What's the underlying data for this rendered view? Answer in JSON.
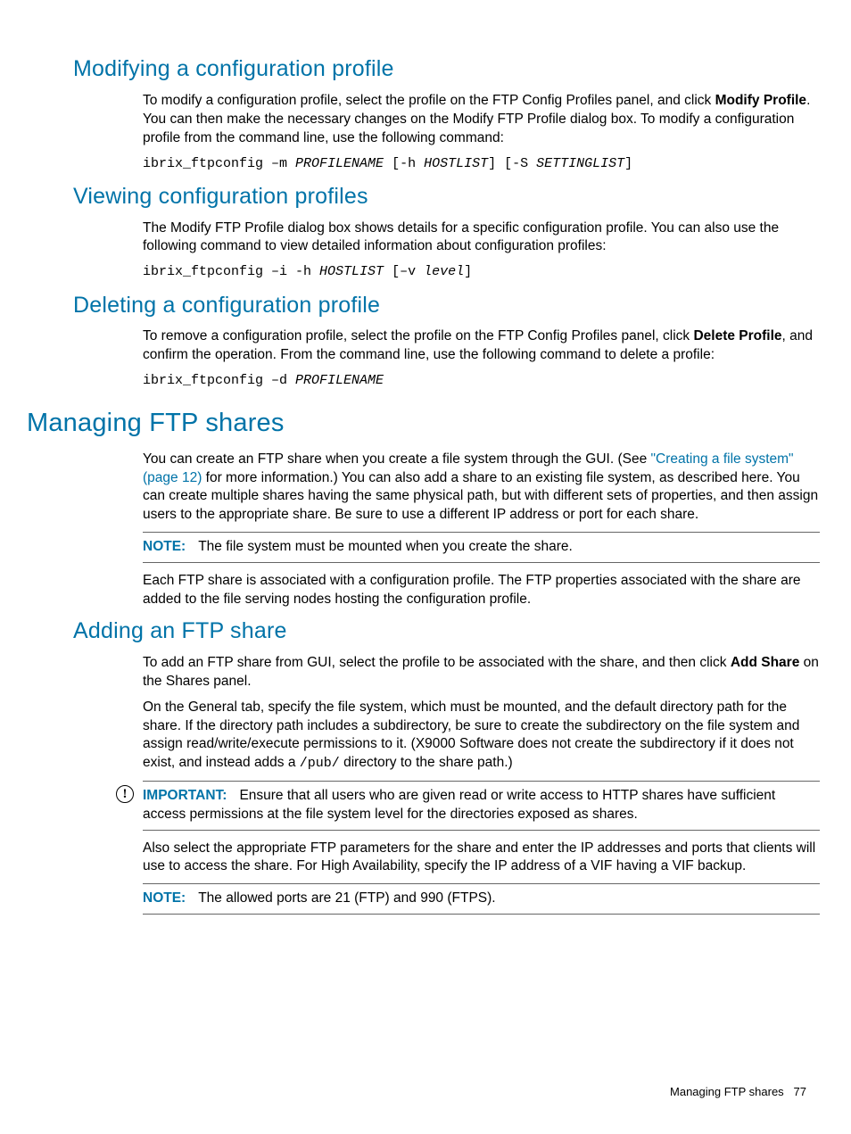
{
  "sec_modify": {
    "title": "Modifying a configuration profile",
    "p1a": "To modify a configuration profile, select the profile on the FTP Config Profiles panel, and click ",
    "p1b": "Modify Profile",
    "p1c": ". You can then make the necessary changes on the Modify FTP Profile dialog box. To modify a configuration profile from the command line, use the following command:",
    "cmd_a": "ibrix_ftpconfig –m ",
    "cmd_b": "PROFILENAME",
    "cmd_c": " [-h ",
    "cmd_d": "HOSTLIST",
    "cmd_e": "] [-S ",
    "cmd_f": "SETTINGLIST",
    "cmd_g": "]"
  },
  "sec_view": {
    "title": "Viewing configuration profiles",
    "p1": "The Modify FTP Profile dialog box shows details for a specific configuration profile. You can also use the following command to view detailed information about configuration profiles:",
    "cmd_a": "ibrix_ftpconfig –i -h ",
    "cmd_b": "HOSTLIST",
    "cmd_c": " [–v ",
    "cmd_d": "level",
    "cmd_e": "]"
  },
  "sec_delete": {
    "title": "Deleting a configuration profile",
    "p1a": "To remove a configuration profile, select the profile on the FTP Config Profiles panel, click ",
    "p1b": "Delete Profile",
    "p1c": ", and confirm the operation. From the command line, use the following command to delete a profile:",
    "cmd_a": "ibrix_ftpconfig –d ",
    "cmd_b": "PROFILENAME"
  },
  "sec_managing": {
    "title": "Managing FTP shares",
    "p1a": "You can create an FTP share when you create a file system through the GUI. (See ",
    "link1": "\"Creating a file system\" (page 12)",
    "p1b": " for more information.) You can also add a share to an existing file system, as described here. You can create multiple shares having the same physical path, but with different sets of properties, and then assign users to the appropriate share. Be sure to use a different IP address or port for each share.",
    "note_label": "NOTE:",
    "note1": "The file system must be mounted when you create the share.",
    "p2": "Each FTP share is associated with a configuration profile. The FTP properties associated with the share are added to the file serving nodes hosting the configuration profile."
  },
  "sec_adding": {
    "title": "Adding an FTP share",
    "p1a": "To add an FTP share from GUI, select the profile to be associated with the share, and then click ",
    "p1b": "Add Share",
    "p1c": " on the Shares panel.",
    "p2a": "On the General tab, specify the file system, which must be mounted, and the default directory path for the share. If the directory path includes a subdirectory, be sure to create the subdirectory on the file system and assign read/write/execute permissions to it. (X9000 Software does not create the subdirectory if it does not exist, and instead adds a ",
    "p2_mono": "/pub/",
    "p2b": " directory to the share path.)",
    "imp_label": "IMPORTANT:",
    "imp_text": "Ensure that all users who are given read or write access to HTTP shares have sufficient access permissions at the file system level for the directories exposed as shares.",
    "p3": "Also select the appropriate FTP parameters for the share and enter the IP addresses and ports that clients will use to access the share. For High Availability, specify the IP address of a VIF having a VIF backup.",
    "note_label": "NOTE:",
    "note2": "The allowed ports are 21 (FTP) and 990 (FTPS)."
  },
  "footer": {
    "text": "Managing FTP shares",
    "page": "77"
  }
}
